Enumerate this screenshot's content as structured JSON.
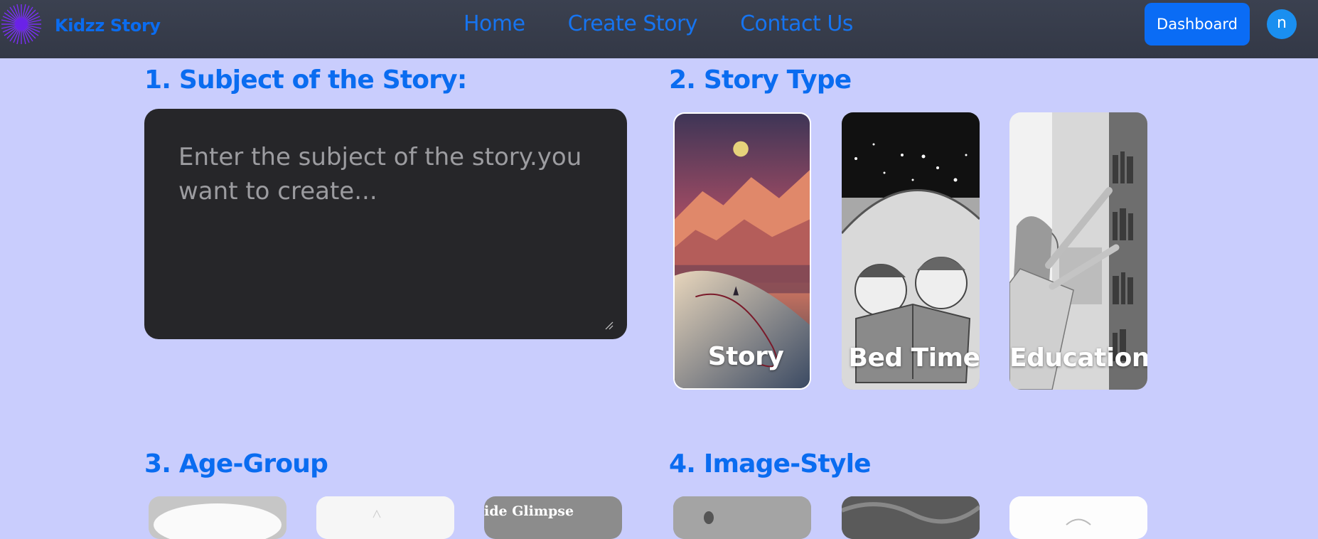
{
  "nav": {
    "brand": "Kidzz Story",
    "links": [
      "Home",
      "Create Story",
      "Contact Us"
    ],
    "dashboard_label": "Dashboard",
    "avatar_letter": "n"
  },
  "sections": {
    "subject": {
      "heading": "1. Subject of the Story:",
      "placeholder": "Enter the subject of the story.you want to create..."
    },
    "story_type": {
      "heading": "2. Story Type",
      "options": [
        "Story",
        "Bed Time",
        "Educational"
      ]
    },
    "age_group": {
      "heading": "3. Age-Group",
      "card_text": "ide Glimpse"
    },
    "image_style": {
      "heading": "4. Image-Style"
    }
  },
  "colors": {
    "page_bg": "#c9cdfd",
    "navbar_bg": "#363b49",
    "accent": "#0a6cf0",
    "textarea_bg": "#262629"
  }
}
